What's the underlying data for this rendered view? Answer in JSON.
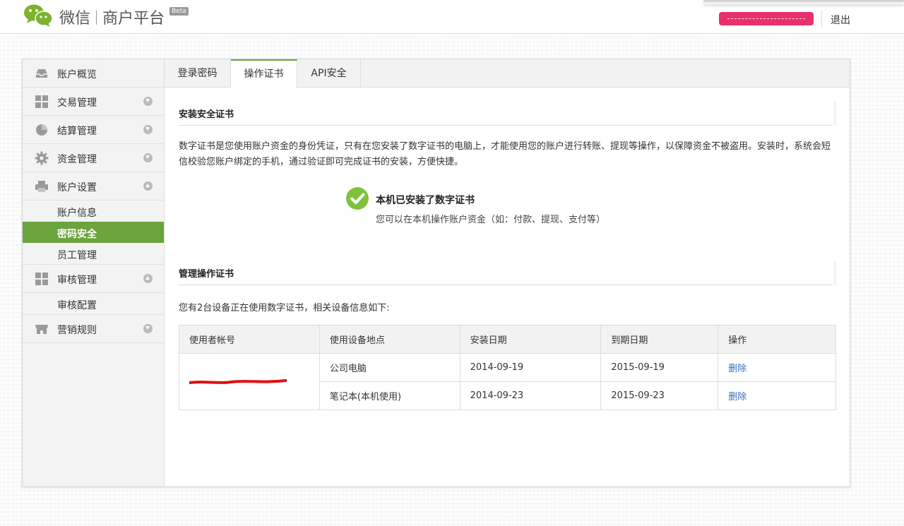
{
  "header": {
    "brand_wechat": "微信",
    "brand_platform": "商户平台",
    "beta_badge": "Beta",
    "logout_label": "退出"
  },
  "sidebar": {
    "items": [
      {
        "label": "账户概览",
        "icon": "inbox-icon"
      },
      {
        "label": "交易管理",
        "icon": "grid-icon"
      },
      {
        "label": "结算管理",
        "icon": "pie-chart-icon"
      },
      {
        "label": "资金管理",
        "icon": "gear-icon"
      },
      {
        "label": "账户设置",
        "icon": "printer-icon"
      },
      {
        "label": "审核管理",
        "icon": "grid-icon"
      },
      {
        "label": "营销规则",
        "icon": "store-icon"
      }
    ],
    "account_settings_children": [
      "账户信息",
      "密码安全",
      "员工管理"
    ],
    "audit_children": [
      "审核配置"
    ],
    "active_item": "密码安全",
    "accent_color": "#6ba43c"
  },
  "tabs": [
    "登录密码",
    "操作证书",
    "API安全"
  ],
  "active_tab": "操作证书",
  "install_section": {
    "title": "安装安全证书",
    "description": "数字证书是您使用账户资金的身份凭证，只有在您安装了数字证书的电脑上，才能使用您的账户进行转账、提现等操作，以保障资金不被盗用。安装时，系统会短信校验您账户绑定的手机，通过验证即可完成证书的安装，方便快捷。",
    "status_title": "本机已安装了数字证书",
    "status_desc": "您可以在本机操作账户资金（如：付款、提现、支付等）",
    "status_icon": "check-circle-icon"
  },
  "manage_section": {
    "title": "管理操作证书",
    "device_count_text": "您有2台设备正在使用数字证书，相关设备信息如下:",
    "columns": [
      "使用者帐号",
      "使用设备地点",
      "安装日期",
      "到期日期",
      "操作"
    ],
    "rows": [
      {
        "location": "公司电脑",
        "install_date": "2014-09-19",
        "expire_date": "2015-09-19",
        "action": "删除"
      },
      {
        "location": "笔记本(本机使用)",
        "install_date": "2014-09-23",
        "expire_date": "2015-09-23",
        "action": "删除"
      }
    ]
  }
}
